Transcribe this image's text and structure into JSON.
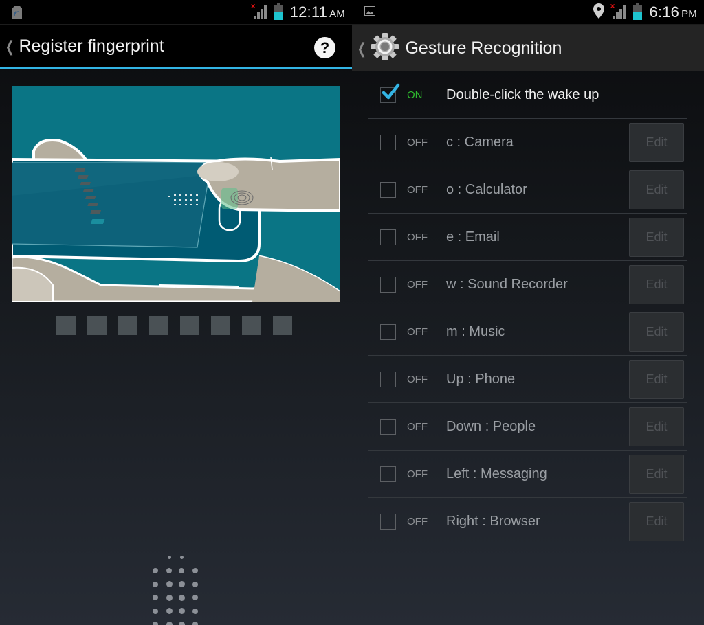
{
  "left_screen": {
    "status_bar": {
      "notification_icon": "data-card-icon",
      "time": "12:11",
      "ampm": "AM",
      "signal_icon": "signal-no-service-icon",
      "battery_icon": "battery-icon"
    },
    "action_bar": {
      "back_glyph": "❮",
      "title": "Register fingerprint",
      "help_glyph": "?"
    },
    "illustration": "finger-on-home-button-scanner-illustration",
    "progress": {
      "total_steps": 8,
      "completed_steps": 0
    }
  },
  "right_screen": {
    "status_bar": {
      "notification_icon": "image-icon",
      "time": "6:16",
      "ampm": "PM",
      "location_icon": "location-pin-icon",
      "signal_icon": "signal-no-service-icon",
      "battery_icon": "battery-icon"
    },
    "action_bar": {
      "back_glyph": "❮",
      "title": "Gesture Recognition",
      "icon": "settings-gear-icon"
    },
    "gestures": [
      {
        "checked": true,
        "state": "ON",
        "label": "Double-click the wake up",
        "edit": null
      },
      {
        "checked": false,
        "state": "OFF",
        "label": "c : Camera",
        "edit": "Edit"
      },
      {
        "checked": false,
        "state": "OFF",
        "label": "o : Calculator",
        "edit": "Edit"
      },
      {
        "checked": false,
        "state": "OFF",
        "label": "e : Email",
        "edit": "Edit"
      },
      {
        "checked": false,
        "state": "OFF",
        "label": "w : Sound Recorder",
        "edit": "Edit"
      },
      {
        "checked": false,
        "state": "OFF",
        "label": "m : Music",
        "edit": "Edit"
      },
      {
        "checked": false,
        "state": "OFF",
        "label": "Up : Phone",
        "edit": "Edit"
      },
      {
        "checked": false,
        "state": "OFF",
        "label": "Down : People",
        "edit": "Edit"
      },
      {
        "checked": false,
        "state": "OFF",
        "label": "Left : Messaging",
        "edit": "Edit"
      },
      {
        "checked": false,
        "state": "OFF",
        "label": "Right : Browser",
        "edit": "Edit"
      }
    ]
  },
  "colors": {
    "accent_blue": "#33b5e5",
    "on_green": "#2eb82e",
    "battery_teal": "#1ec4cf",
    "illustration_teal": "#0a7585"
  }
}
